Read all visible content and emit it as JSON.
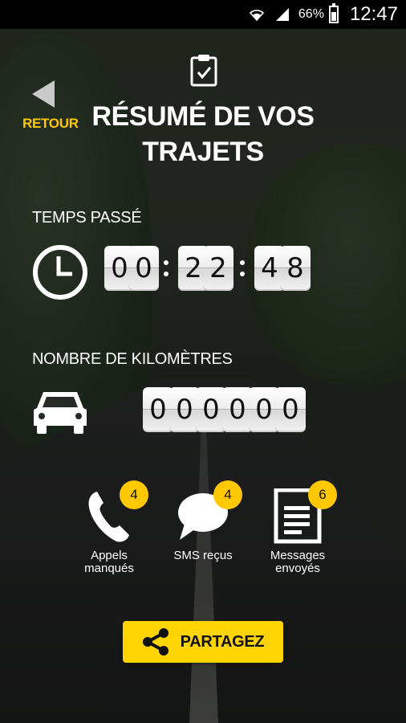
{
  "status_bar": {
    "battery_percent": "66%",
    "time": "12:47",
    "icons": [
      "wifi-icon",
      "signal-icon",
      "battery-icon"
    ]
  },
  "header": {
    "back_label": "RETOUR",
    "title_line1": "RÉSUMÉ DE VOS",
    "title_line2": "TRAJETS",
    "icon": "clipboard-check-icon"
  },
  "time_spent": {
    "label": "TEMPS PASSÉ",
    "icon": "clock-icon",
    "digits": [
      "0",
      "0",
      "2",
      "2",
      "4",
      "8"
    ]
  },
  "kilometers": {
    "label": "NOMBRE DE KILOMÈTRES",
    "icon": "car-icon",
    "digits": [
      "0",
      "0",
      "0",
      "0",
      "0",
      "0"
    ]
  },
  "stats": {
    "missed_calls": {
      "count": "4",
      "line1": "Appels",
      "line2": "manqués",
      "icon": "phone-icon"
    },
    "sms_received": {
      "count": "4",
      "line1": "SMS reçus",
      "icon": "chat-bubble-icon"
    },
    "messages_sent": {
      "count": "6",
      "line1": "Messages",
      "line2": "envoyés",
      "icon": "document-icon"
    }
  },
  "share": {
    "label": "PARTAGEZ",
    "icon": "share-icon"
  },
  "colors": {
    "accent": "#ffd400",
    "back_label": "#ffc800",
    "badge": "#ffc800"
  }
}
